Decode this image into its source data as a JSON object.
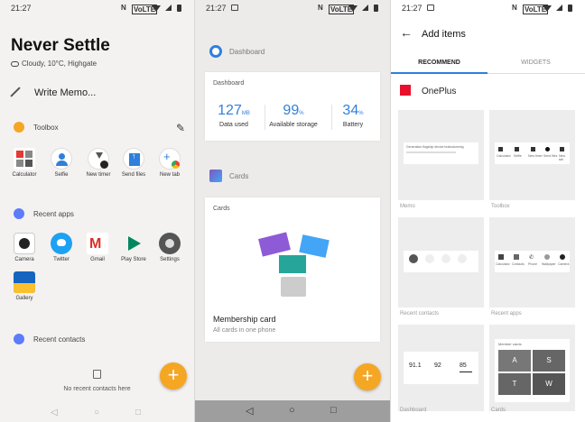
{
  "status": {
    "time": "21:27"
  },
  "home": {
    "title": "Never Settle",
    "weather": "Cloudy, 10°C, Highgate",
    "memo_label": "Write Memo...",
    "toolbox_label": "Toolbox",
    "toolbox_apps": [
      "Calculator",
      "Selfie",
      "New timer",
      "Send files",
      "New tab"
    ],
    "recent_apps_label": "Recent apps",
    "recent_apps": [
      "Camera",
      "Twitter",
      "Gmail",
      "Play Store",
      "Settings",
      "Gallery"
    ],
    "recent_contacts_label": "Recent contacts",
    "no_contacts": "No recent contacts here",
    "fab": "+"
  },
  "shelf": {
    "dashboard_label": "Dashboard",
    "dashboard_card_title": "Dashboard",
    "stats": [
      {
        "num": "127",
        "unit": "MB",
        "caption": "Data used"
      },
      {
        "num": "99",
        "unit": "%",
        "caption": "Available storage"
      },
      {
        "num": "34",
        "unit": "%",
        "caption": "Battery"
      }
    ],
    "cards_label": "Cards",
    "cards_card_title": "Cards",
    "membership_title": "Membership card",
    "membership_sub": "All cards in one phone",
    "fab": "+"
  },
  "add_items": {
    "title": "Add items",
    "tabs": [
      "RECOMMEND",
      "WIDGETS"
    ],
    "brand": "OnePlus",
    "widgets": [
      "Memo",
      "Toolbox",
      "Recent contacts",
      "Recent apps",
      "Dashboard",
      "Cards"
    ],
    "memo_preview": "Generation flagship device brainstorming",
    "toolbox_preview": [
      "Calculator",
      "Selfie",
      "New timer",
      "Send files",
      "New tab"
    ],
    "apps_preview": [
      "Calculator",
      "Contacts",
      "Phone",
      "Wallpaper",
      "Camera"
    ],
    "dashboard_preview": [
      "91.1",
      "92",
      "85"
    ],
    "cards_preview_title": "Member cards",
    "cards_preview_letters": [
      "A",
      "S",
      "T",
      "W"
    ]
  },
  "colors": {
    "accent": "#2f7fdc",
    "fab": "#f5a623",
    "oneplus_red": "#e8102c"
  }
}
